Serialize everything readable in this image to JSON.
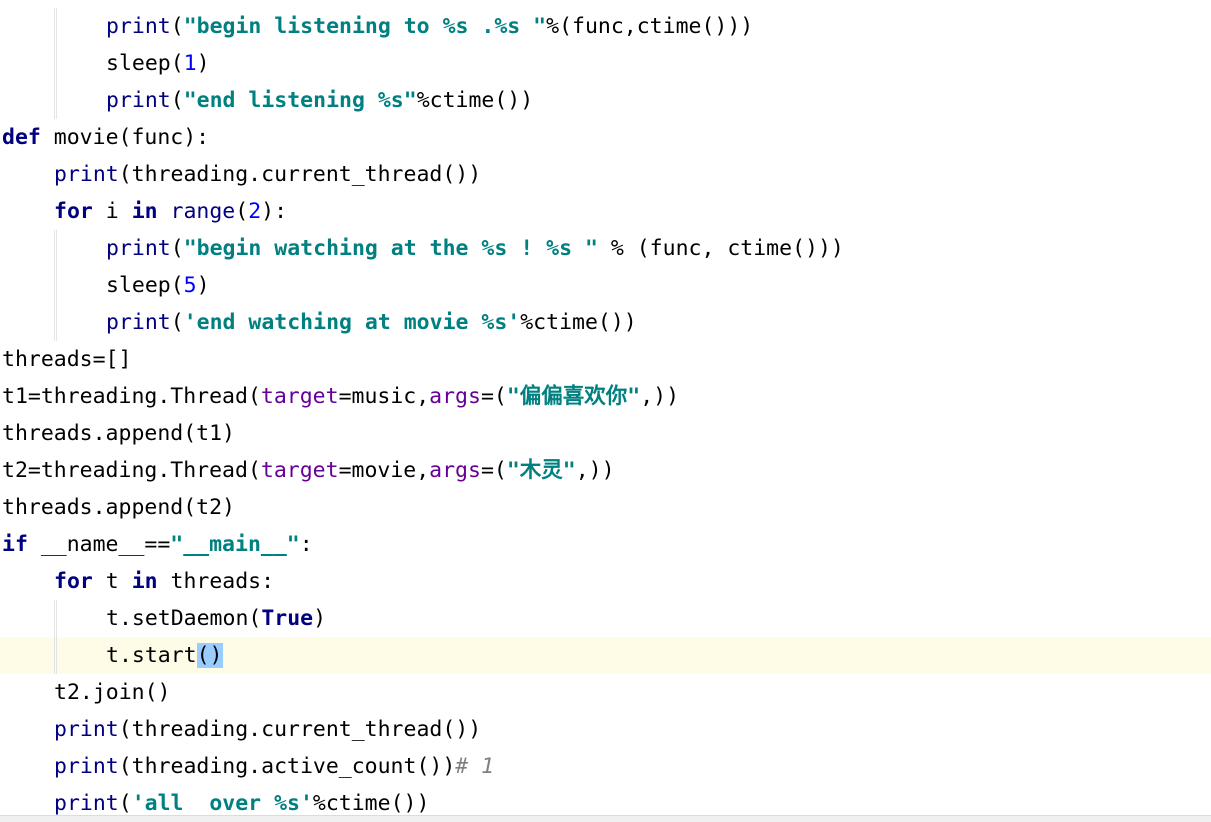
{
  "editor": {
    "colors": {
      "keyword": "#000080",
      "string": "#008080",
      "number": "#0000ff",
      "keyword_argument": "#660099",
      "comment": "#808080",
      "current_line": "#fefce6",
      "bracket_match": "#99ccff"
    },
    "lines": [
      {
        "indent": 2,
        "tokens": [
          {
            "t": "bi",
            "v": "print"
          },
          {
            "t": "p",
            "v": "("
          },
          {
            "t": "str",
            "v": "\"begin listening to %s .%s \""
          },
          {
            "t": "p",
            "v": "%(func,ctime()))"
          }
        ]
      },
      {
        "indent": 2,
        "tokens": [
          {
            "t": "p",
            "v": "sleep("
          },
          {
            "t": "num",
            "v": "1"
          },
          {
            "t": "p",
            "v": ")"
          }
        ]
      },
      {
        "indent": 2,
        "tokens": [
          {
            "t": "bi",
            "v": "print"
          },
          {
            "t": "p",
            "v": "("
          },
          {
            "t": "str",
            "v": "\"end listening %s\""
          },
          {
            "t": "p",
            "v": "%ctime())"
          }
        ]
      },
      {
        "indent": 0,
        "tokens": [
          {
            "t": "kw",
            "v": "def"
          },
          {
            "t": "p",
            "v": " movie(func):"
          }
        ]
      },
      {
        "indent": 1,
        "tokens": [
          {
            "t": "bi",
            "v": "print"
          },
          {
            "t": "p",
            "v": "(threading.current_thread())"
          }
        ]
      },
      {
        "indent": 1,
        "tokens": [
          {
            "t": "kw",
            "v": "for"
          },
          {
            "t": "p",
            "v": " i "
          },
          {
            "t": "kw",
            "v": "in"
          },
          {
            "t": "p",
            "v": " "
          },
          {
            "t": "bi",
            "v": "range"
          },
          {
            "t": "p",
            "v": "("
          },
          {
            "t": "num",
            "v": "2"
          },
          {
            "t": "p",
            "v": "):"
          }
        ]
      },
      {
        "indent": 2,
        "tokens": [
          {
            "t": "bi",
            "v": "print"
          },
          {
            "t": "p",
            "v": "("
          },
          {
            "t": "str",
            "v": "\"begin watching at the %s ! %s \""
          },
          {
            "t": "p",
            "v": " % (func, ctime()))"
          }
        ]
      },
      {
        "indent": 2,
        "tokens": [
          {
            "t": "p",
            "v": "sleep("
          },
          {
            "t": "num",
            "v": "5"
          },
          {
            "t": "p",
            "v": ")"
          }
        ]
      },
      {
        "indent": 2,
        "tokens": [
          {
            "t": "bi",
            "v": "print"
          },
          {
            "t": "p",
            "v": "("
          },
          {
            "t": "str",
            "v": "'end watching at movie %s'"
          },
          {
            "t": "p",
            "v": "%ctime())"
          }
        ]
      },
      {
        "indent": 0,
        "tokens": [
          {
            "t": "p",
            "v": "threads=[]"
          }
        ]
      },
      {
        "indent": 0,
        "tokens": [
          {
            "t": "p",
            "v": "t1=threading.Thread("
          },
          {
            "t": "kwarg",
            "v": "target"
          },
          {
            "t": "p",
            "v": "=music,"
          },
          {
            "t": "kwarg",
            "v": "args"
          },
          {
            "t": "p",
            "v": "=("
          },
          {
            "t": "str",
            "v": "\"偏偏喜欢你\""
          },
          {
            "t": "p",
            "v": ",))"
          }
        ]
      },
      {
        "indent": 0,
        "tokens": [
          {
            "t": "p",
            "v": "threads.append(t1)"
          }
        ]
      },
      {
        "indent": 0,
        "tokens": [
          {
            "t": "p",
            "v": "t2=threading.Thread("
          },
          {
            "t": "kwarg",
            "v": "target"
          },
          {
            "t": "p",
            "v": "=movie,"
          },
          {
            "t": "kwarg",
            "v": "args"
          },
          {
            "t": "p",
            "v": "=("
          },
          {
            "t": "str",
            "v": "\"木灵\""
          },
          {
            "t": "p",
            "v": ",))"
          }
        ]
      },
      {
        "indent": 0,
        "tokens": [
          {
            "t": "p",
            "v": "threads.append(t2)"
          }
        ]
      },
      {
        "indent": 0,
        "tokens": [
          {
            "t": "kw",
            "v": "if"
          },
          {
            "t": "p",
            "v": " __name__=="
          },
          {
            "t": "str",
            "v": "\"__main__\""
          },
          {
            "t": "p",
            "v": ":"
          }
        ]
      },
      {
        "indent": 1,
        "tokens": [
          {
            "t": "kw",
            "v": "for"
          },
          {
            "t": "p",
            "v": " t "
          },
          {
            "t": "kw",
            "v": "in"
          },
          {
            "t": "p",
            "v": " threads:"
          }
        ]
      },
      {
        "indent": 2,
        "tokens": [
          {
            "t": "p",
            "v": "t.setDaemon("
          },
          {
            "t": "kw",
            "v": "True"
          },
          {
            "t": "p",
            "v": ")"
          }
        ]
      },
      {
        "indent": 2,
        "current": true,
        "tokens": [
          {
            "t": "p",
            "v": "t.start"
          },
          {
            "t": "match",
            "v": "()"
          }
        ]
      },
      {
        "indent": 1,
        "tokens": [
          {
            "t": "p",
            "v": "t2.join()"
          }
        ]
      },
      {
        "indent": 1,
        "tokens": [
          {
            "t": "bi",
            "v": "print"
          },
          {
            "t": "p",
            "v": "(threading.current_thread())"
          }
        ]
      },
      {
        "indent": 1,
        "tokens": [
          {
            "t": "bi",
            "v": "print"
          },
          {
            "t": "p",
            "v": "(threading.active_count())"
          },
          {
            "t": "cmt",
            "v": "# 1"
          }
        ]
      },
      {
        "indent": 1,
        "tokens": [
          {
            "t": "bi",
            "v": "print"
          },
          {
            "t": "p",
            "v": "("
          },
          {
            "t": "str",
            "v": "'all  over %s'"
          },
          {
            "t": "p",
            "v": "%ctime())"
          }
        ]
      }
    ]
  }
}
